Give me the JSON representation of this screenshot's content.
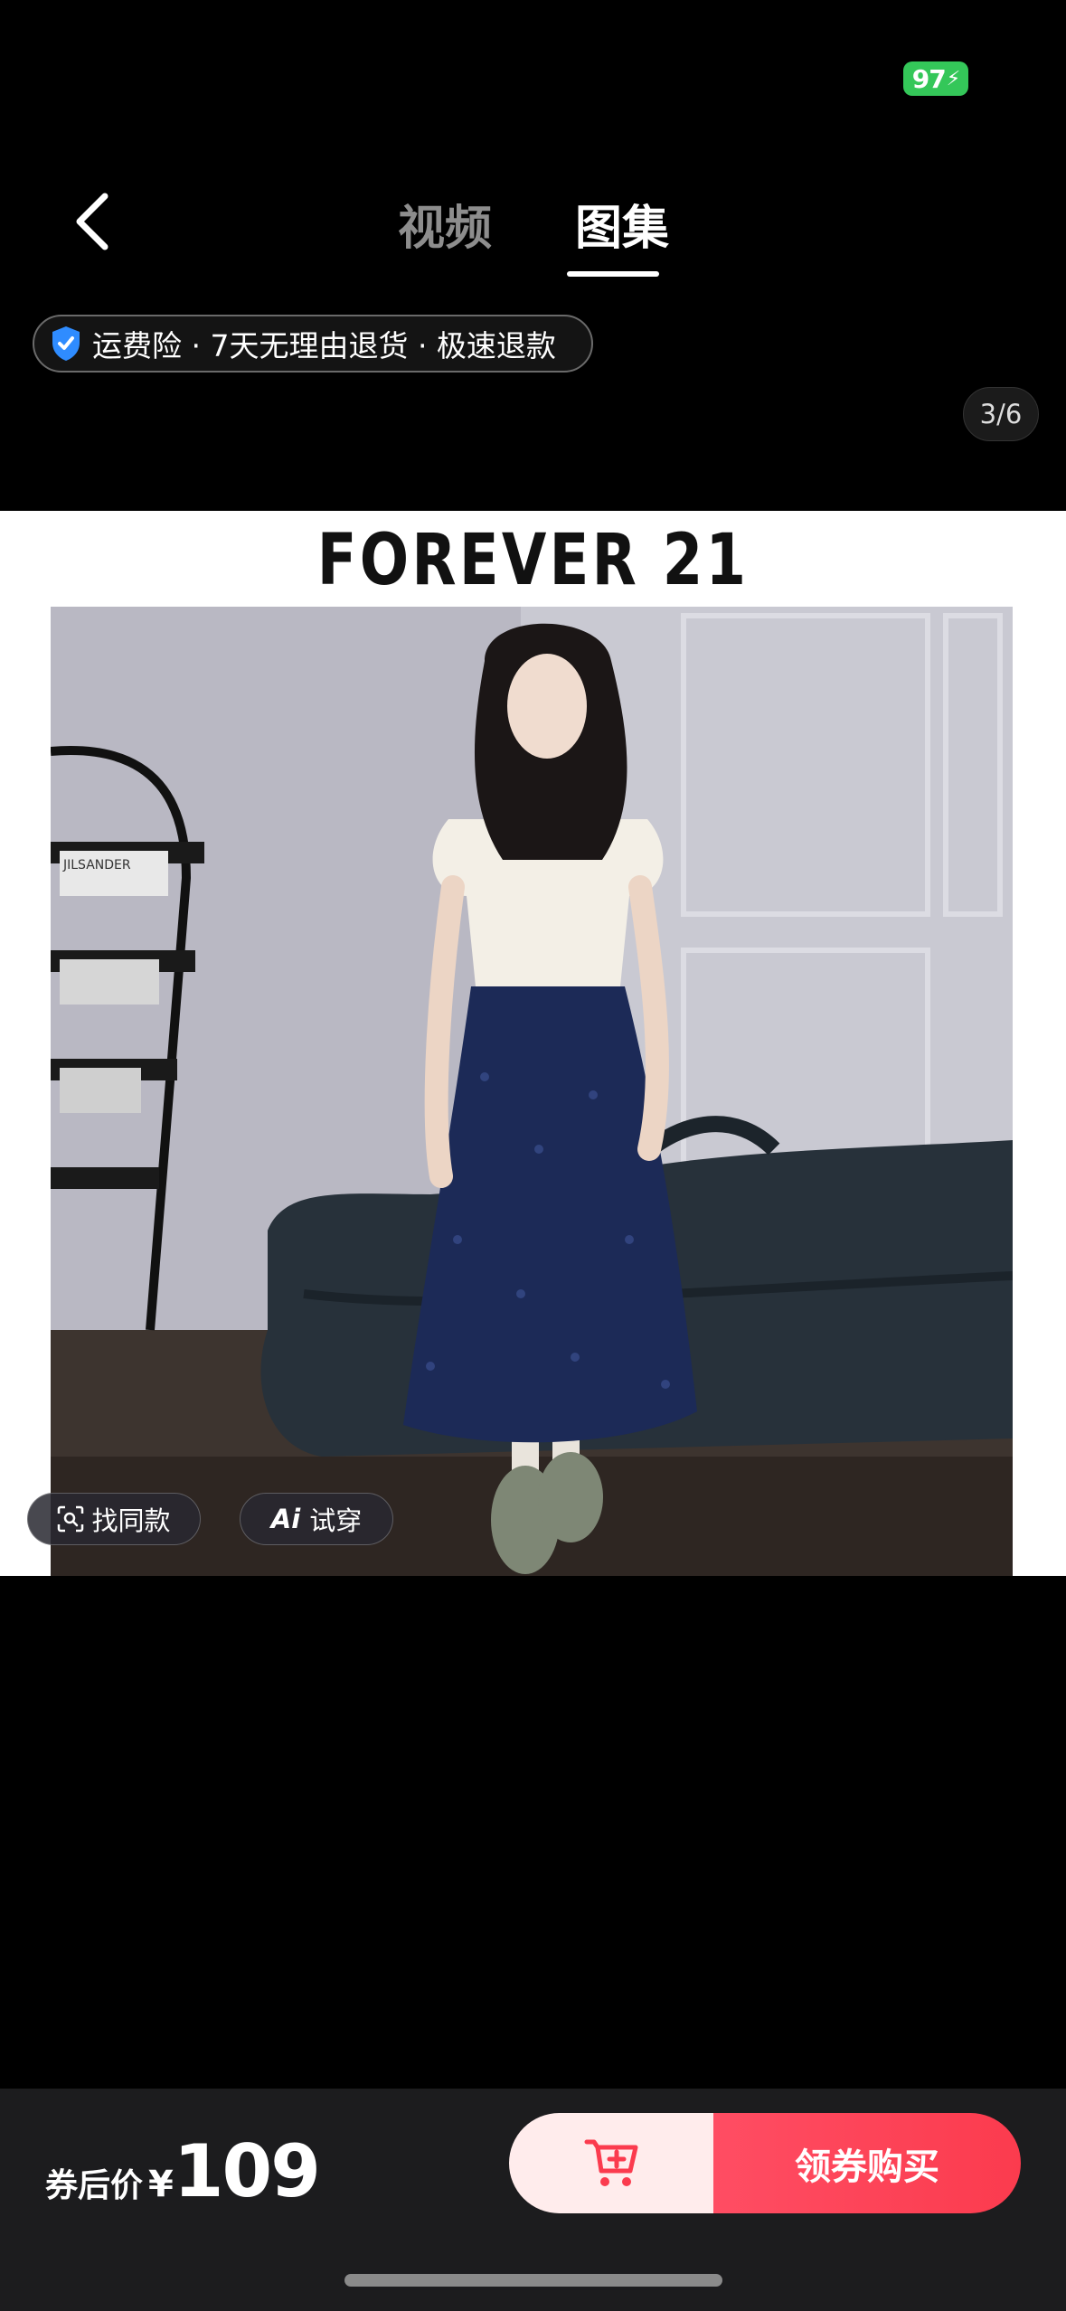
{
  "status_bar": {
    "battery": "97"
  },
  "nav": {
    "tabs": [
      {
        "label": "视频",
        "active": false
      },
      {
        "label": "图集",
        "active": true
      }
    ]
  },
  "service_pill": {
    "text": "运费险 · 7天无理由退货 · 极速退款"
  },
  "page_counter": "3/6",
  "product_image": {
    "brand": "FOREVER 21",
    "magazine_label": "JILSANDER"
  },
  "overlay_buttons": {
    "find_similar": "找同款",
    "ai_tryon_icon": "Ai",
    "ai_tryon": "试穿"
  },
  "bottom_bar": {
    "price_label": "券后价",
    "currency": "¥",
    "price": "109",
    "buy_label": "领券购买"
  },
  "colors": {
    "accent": "#fb3b4e",
    "battery": "#34c759",
    "cart_bg": "#ffecec"
  },
  "icons": [
    "back-chevron",
    "shield-check",
    "scan",
    "cart-plus"
  ]
}
